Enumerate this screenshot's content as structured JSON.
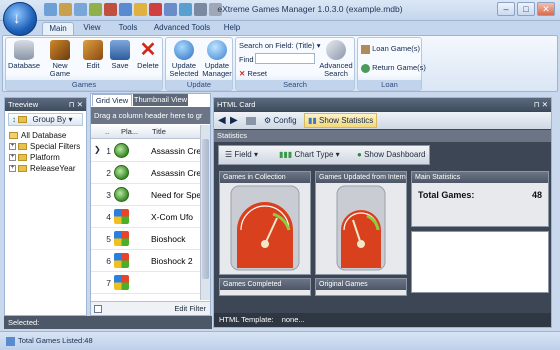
{
  "window": {
    "title": "eXtreme Games Manager 1.0.3.0 (example.mdb)",
    "controls": [
      "–",
      "□",
      "✕"
    ]
  },
  "ribbon": {
    "tabs": [
      "Main",
      "View",
      "Tools",
      "Advanced Tools",
      "Help"
    ],
    "games_group": {
      "label": "Games",
      "buttons": [
        {
          "label": "Database",
          "icon": "database-icon"
        },
        {
          "label": "New Game",
          "icon": "new-game-icon"
        },
        {
          "label": "Edit",
          "icon": "edit-icon"
        },
        {
          "label": "Save",
          "icon": "save-icon"
        },
        {
          "label": "Delete",
          "icon": "delete-icon"
        }
      ]
    },
    "update_group": {
      "label": "Update",
      "buttons": [
        {
          "label": "Update Selected",
          "icon": "update-selected-icon"
        },
        {
          "label": "Update Manager",
          "icon": "update-manager-icon"
        }
      ]
    },
    "search_group": {
      "label": "Search",
      "field_label": "Search on Field: (Title)",
      "find_label": "Find",
      "find_value": "",
      "reset_label": "Reset",
      "advanced_label": "Advanced Search"
    },
    "loan_group": {
      "label": "Loan",
      "loan_label": "Loan Game(s)",
      "return_label": "Return Game(s)"
    }
  },
  "treeview": {
    "header": "Treeview",
    "group_by": "Group By",
    "items": [
      "All Database",
      "Special Filters",
      "Platform",
      "ReleaseYear"
    ]
  },
  "grid": {
    "tabs": [
      "Grid View",
      "Thumbnail View"
    ],
    "drag_hint": "Drag a column header here to gr",
    "columns": [
      "..",
      "Pla...",
      "Title"
    ],
    "rows": [
      {
        "num": "1",
        "title": "Assassin Cre",
        "platform": "xbox-icon",
        "selected": true
      },
      {
        "num": "2",
        "title": "Assassin Cre",
        "platform": "xbox-icon",
        "selected": false
      },
      {
        "num": "3",
        "title": "Need for Spe",
        "platform": "xbox-icon",
        "selected": false
      },
      {
        "num": "4",
        "title": "X-Com Ufo",
        "platform": "windows-icon",
        "selected": false
      },
      {
        "num": "5",
        "title": "Bioshock",
        "platform": "windows-icon",
        "selected": false
      },
      {
        "num": "6",
        "title": "Bioshock 2",
        "platform": "windows-icon",
        "selected": false
      },
      {
        "num": "7",
        "title": "",
        "platform": "windows-icon",
        "selected": false
      }
    ],
    "edit_filter": "Edit Filter"
  },
  "card": {
    "header": "HTML Card",
    "config": "Config",
    "show_statistics": "Show Statistics",
    "statistics_label": "Statistics",
    "field_label": "Field",
    "chart_type_label": "Chart Type",
    "dashboard_label": "Show Dashboard",
    "tiles": {
      "games_in_collection": "Games in Collection",
      "games_updated": "Games Updated from Internet",
      "main_statistics": "Main Statistics",
      "games_completed": "Games Completed",
      "original_games": "Original Games"
    },
    "total_games_label": "Total Games:",
    "total_games_value": "48",
    "template_label": "HTML Template:",
    "template_value": "none..."
  },
  "status": {
    "selected": "Selected:",
    "total": "Total Games Listed:48"
  },
  "colors": {
    "accent": "#2a5fa8",
    "gauge_red": "#d9401e",
    "dark_panel": "#3d4654"
  }
}
